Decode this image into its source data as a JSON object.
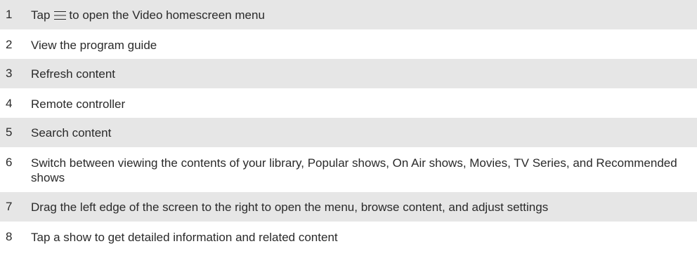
{
  "rows": [
    {
      "number": "1",
      "text_before_icon": "Tap",
      "icon": "menu-icon",
      "text_after_icon": "to open the Video homescreen menu"
    },
    {
      "number": "2",
      "text": "View the program guide"
    },
    {
      "number": "3",
      "text": "Refresh content"
    },
    {
      "number": "4",
      "text": "Remote controller"
    },
    {
      "number": "5",
      "text": "Search content"
    },
    {
      "number": "6",
      "text": "Switch between viewing the contents of your library, Popular shows, On Air shows, Movies, TV Series, and Recommended shows"
    },
    {
      "number": "7",
      "text": "Drag the left edge of the screen to the right to open the menu, browse content, and adjust settings"
    },
    {
      "number": "8",
      "text": "Tap a show to get detailed information and related content"
    }
  ],
  "colors": {
    "shaded_row": "#e6e6e6",
    "text": "#2a2a2a"
  }
}
